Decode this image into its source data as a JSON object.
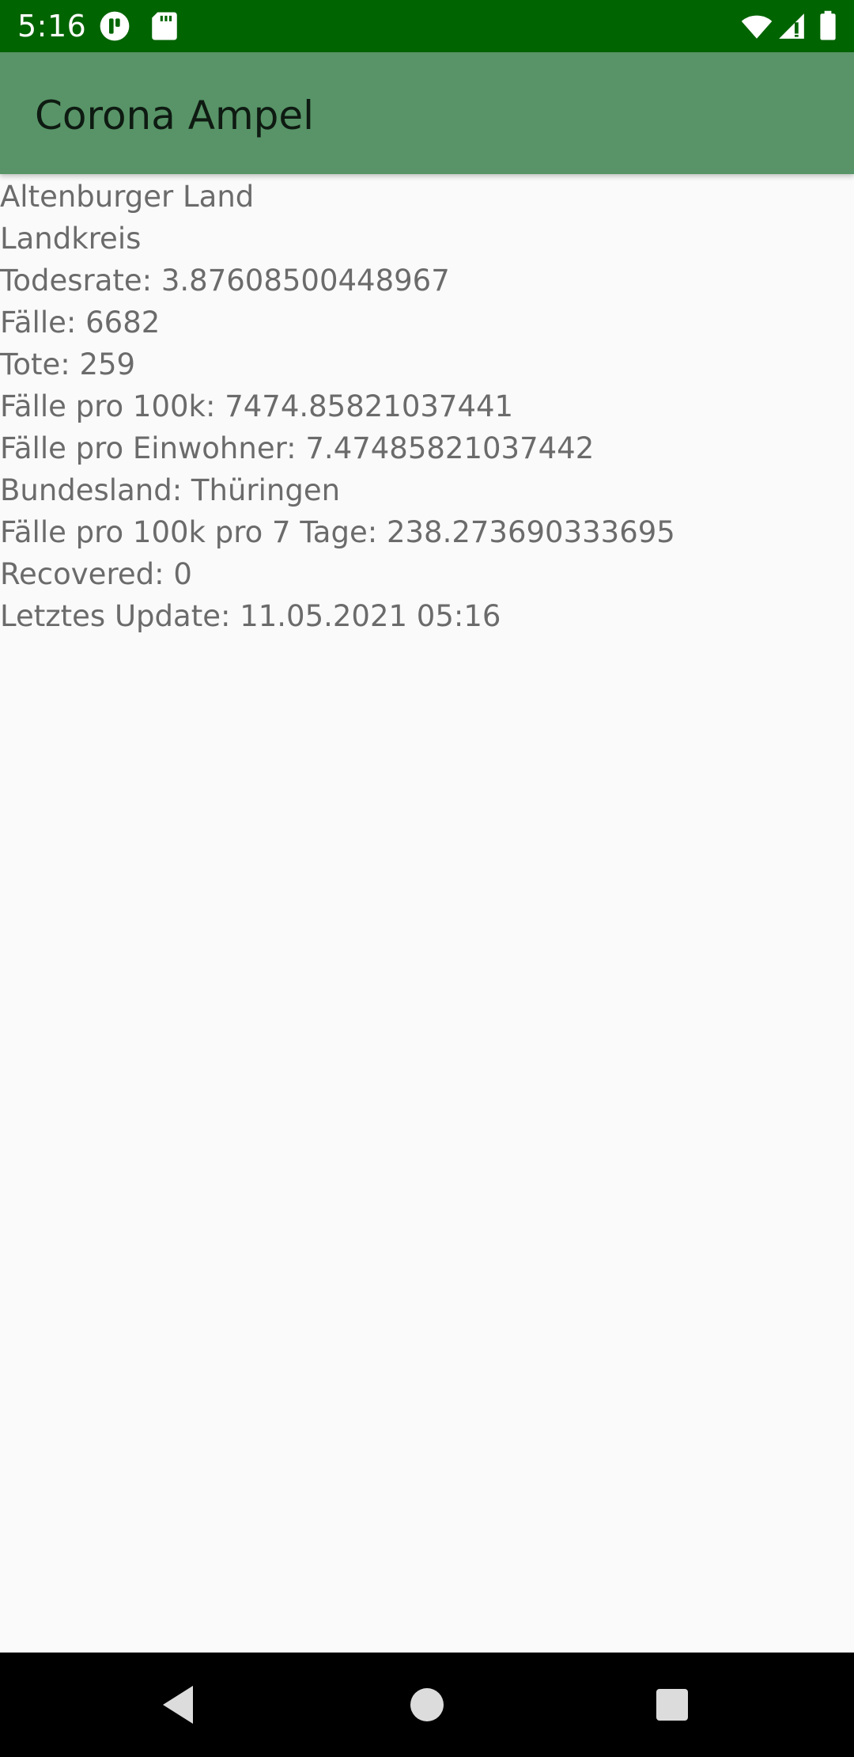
{
  "status_bar": {
    "time": "5:16",
    "left_icons": [
      "pocket-icon",
      "sd-card-icon"
    ],
    "right_icons": [
      "wifi-icon",
      "cell-signal-icon",
      "battery-icon"
    ],
    "color": "#006400"
  },
  "app_bar": {
    "title": "Corona Ampel",
    "color": "#589467"
  },
  "info": {
    "lines": [
      "Altenburger Land",
      "Landkreis",
      "Todesrate: 3.87608500448967",
      "Fälle: 6682",
      "Tote: 259",
      "Fälle pro 100k: 7474.85821037441",
      "Fälle pro Einwohner: 7.47485821037442",
      "Bundesland: Thüringen",
      "Fälle pro 100k pro 7 Tage: 238.273690333695",
      "Recovered: 0",
      "Letztes Update: 11.05.2021 05:16"
    ]
  },
  "nav_bar": {
    "buttons": [
      "back-icon",
      "home-icon",
      "recents-icon"
    ]
  }
}
